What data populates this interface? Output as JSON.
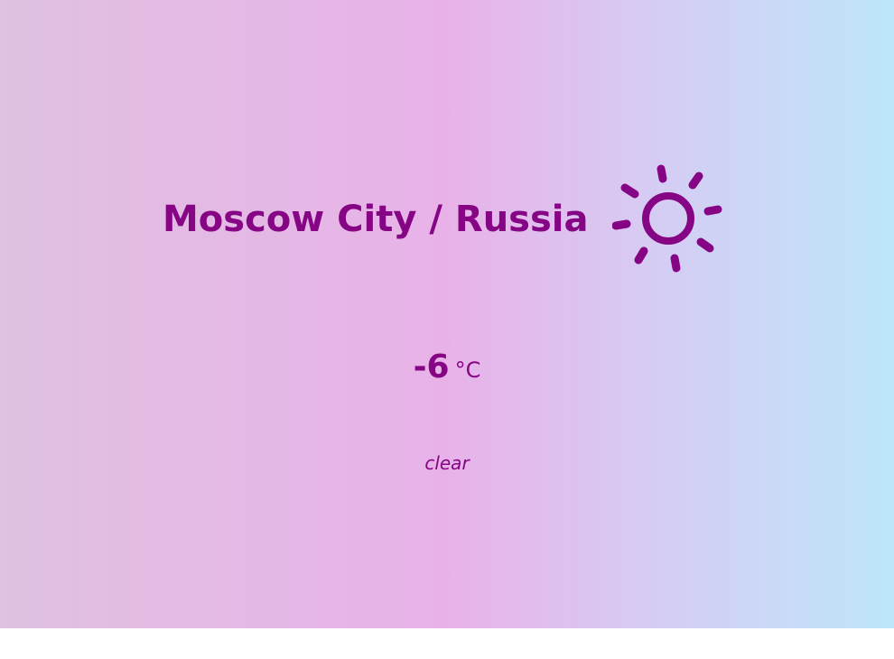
{
  "weather": {
    "location": "Moscow City / Russia",
    "temperature": "-6",
    "unit": "°C",
    "description": "clear",
    "icon": "sun-icon",
    "accent_color": "#850585"
  }
}
